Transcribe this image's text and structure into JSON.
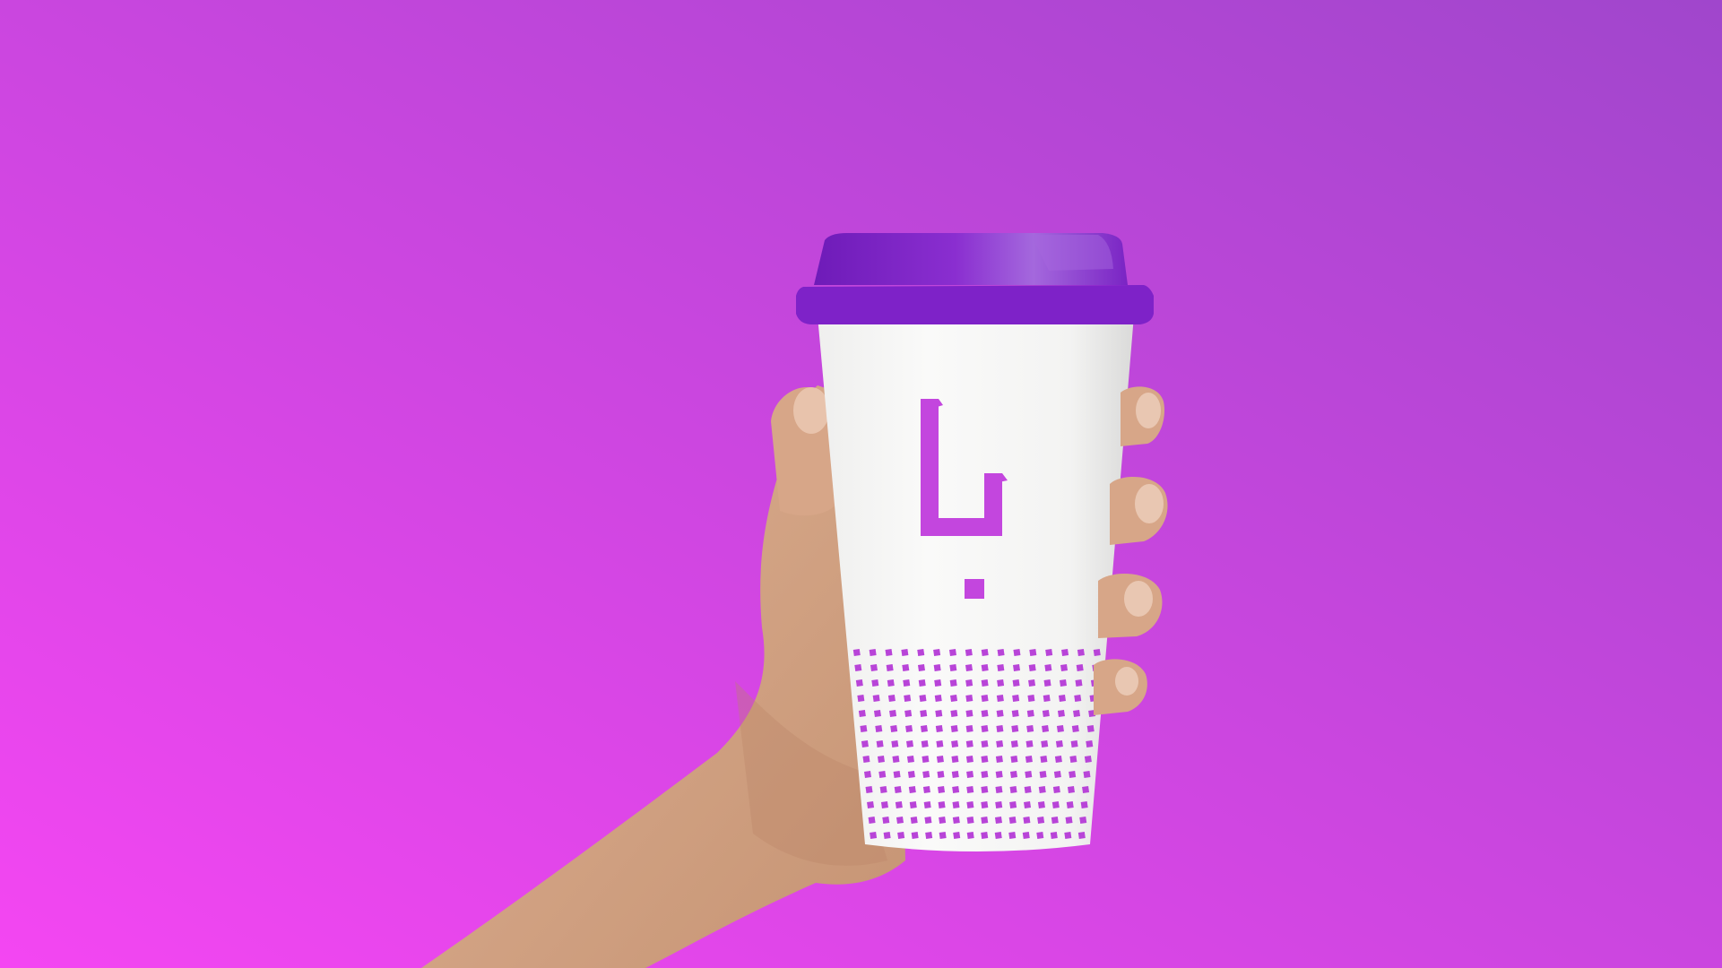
{
  "scene": {
    "description_tag": "product-mockup",
    "colors": {
      "background_left": "#F446F2",
      "background_right": "#A046CC",
      "lid": "#7E22C8",
      "lid_highlight": "#A565DE",
      "cup": "#F5F5F4",
      "logo": "#C346DE",
      "pattern": "#B844D8",
      "skin": "#D7A688",
      "skin_shadow": "#B98467"
    },
    "icons": {
      "logo": "brand-logo-icon",
      "pattern": "dot-pattern"
    },
    "pattern": {
      "rows": 13,
      "columns": 16
    }
  }
}
